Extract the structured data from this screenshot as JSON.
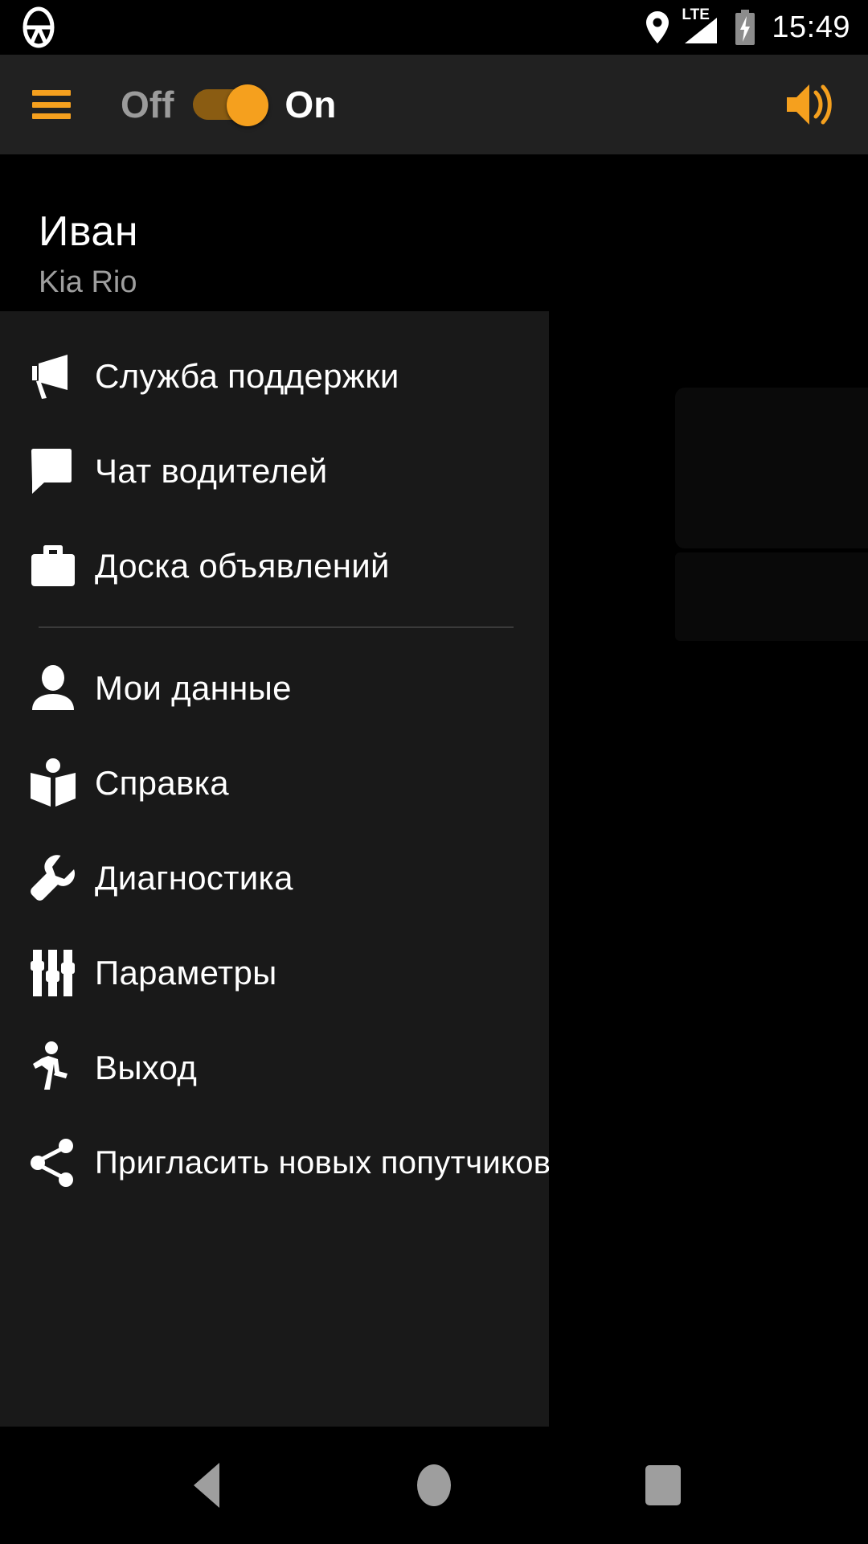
{
  "status_bar": {
    "app_icon": "steering-wheel-icon",
    "location_icon": "location-pin-icon",
    "network_label": "LTE",
    "signal_icon": "signal-bars-icon",
    "battery_icon": "battery-charging-icon",
    "time": "15:49"
  },
  "toolbar": {
    "menu_icon": "hamburger-menu-icon",
    "off_label": "Off",
    "on_label": "On",
    "switch_state": "on",
    "volume_icon": "volume-up-icon",
    "accent_color": "#f5a01e",
    "background_color": "#212121"
  },
  "drawer": {
    "profile": {
      "name": "Иван",
      "car": "Kia Rio"
    },
    "items": [
      {
        "label": "Служба поддержки",
        "icon": "megaphone-icon"
      },
      {
        "label": "Чат водителей",
        "icon": "chat-bubble-icon"
      },
      {
        "label": "Доска объявлений",
        "icon": "briefcase-icon"
      },
      {
        "label": "Мои данные",
        "icon": "person-icon"
      },
      {
        "label": "Справка",
        "icon": "open-book-icon"
      },
      {
        "label": "Диагностика",
        "icon": "wrench-icon"
      },
      {
        "label": "Параметры",
        "icon": "sliders-icon"
      },
      {
        "label": "Выход",
        "icon": "running-person-icon"
      },
      {
        "label": "Пригласить новых попутчиков",
        "icon": "share-icon"
      }
    ]
  },
  "navbar": {
    "back_icon": "back-triangle-icon",
    "home_icon": "home-circle-icon",
    "recents_icon": "recents-square-icon",
    "icon_color": "#9e9e9e"
  }
}
